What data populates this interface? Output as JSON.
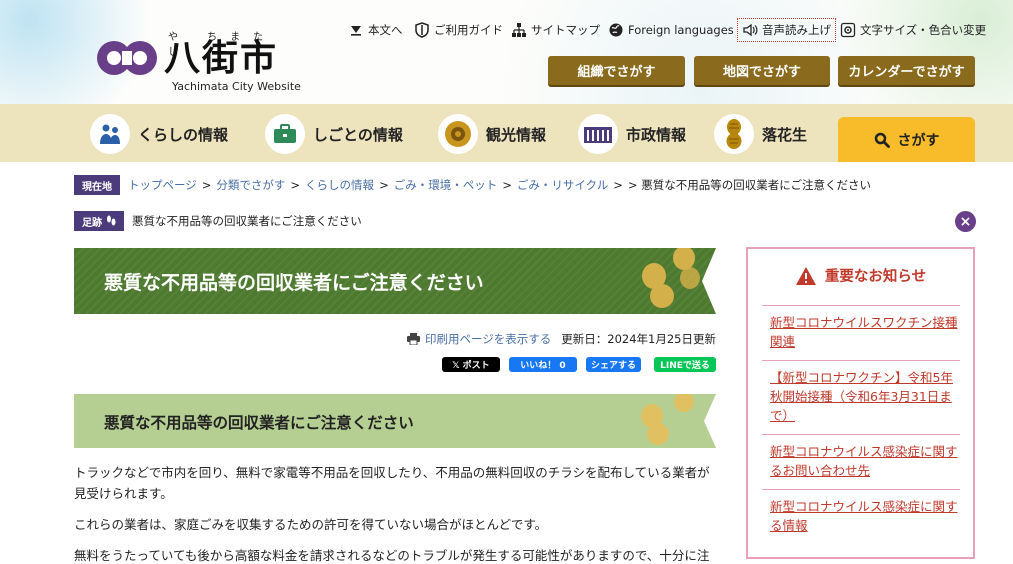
{
  "header": {
    "logo": {
      "kana": "や ちまた し",
      "kanji": "八街市",
      "en": "Yachimata City Website"
    },
    "utility": [
      {
        "label": "本文へ",
        "icon": "arrow-down-icon"
      },
      {
        "label": "ご利用ガイド",
        "icon": "shield-icon"
      },
      {
        "label": "サイトマップ",
        "icon": "sitemap-icon"
      },
      {
        "label": "Foreign languages",
        "icon": "globe-icon"
      },
      {
        "label": "音声読み上げ",
        "icon": "speaker-icon"
      },
      {
        "label": "文字サイズ・色合い変更",
        "icon": "gear-icon"
      }
    ],
    "search_buttons": [
      "組織でさがす",
      "地図でさがす",
      "カレンダーでさがす"
    ]
  },
  "nav": {
    "items": [
      {
        "label": "くらしの情報",
        "icon": "family-icon"
      },
      {
        "label": "しごとの情報",
        "icon": "briefcase-icon"
      },
      {
        "label": "観光情報",
        "icon": "sunflower-icon"
      },
      {
        "label": "市政情報",
        "icon": "building-icon"
      },
      {
        "label": "落花生",
        "icon": "peanut-icon"
      }
    ],
    "search_label": "さがす"
  },
  "breadcrumb": {
    "tag": "現在地",
    "links": [
      "トップページ",
      "分類でさがす",
      "くらしの情報",
      "ごみ・環境・ペット",
      "ごみ・リサイクル"
    ],
    "separator": ">",
    "current": "> 悪質な不用品等の回収業者にご注意ください"
  },
  "footprint": {
    "tag": "足跡",
    "current": "悪質な不用品等の回収業者にご注意ください"
  },
  "article": {
    "title": "悪質な不用品等の回収業者にご注意ください",
    "print_label": "印刷用ページを表示する",
    "updated": "更新日：2024年1月25日更新",
    "share": {
      "x": "𝕏 ポスト",
      "fb": "いいね！ 0",
      "hatena": "シェアする",
      "line": "LINEで送る"
    },
    "heading": "悪質な不用品等の回収業者にご注意ください",
    "paragraphs": [
      "トラックなどで市内を回り、無料で家電等不用品を回収したり、不用品の無料回収のチラシを配布している業者が見受けられます。",
      "これらの業者は、家庭ごみを収集するための許可を得ていない場合がほとんどです。",
      "無料をうたっていても後から高額な料金を請求されるなどのトラブルが発生する可能性がありますので、十分に注意"
    ]
  },
  "notice": {
    "title": "重要なお知らせ",
    "items": [
      "新型コロナウイルスワクチン接種関連",
      "【新型コロナワクチン】令和5年秋開始接種（令和6年3月31日まで）",
      "新型コロナウイルス感染症に関するお問い合わせ先",
      "新型コロナウイルス感染症に関する情報"
    ]
  },
  "colors": {
    "brand_purple": "#6a3f8a",
    "nav_bg": "#ede3bd",
    "search_btn": "#8a6a1d",
    "banner_green": "#4e7a2f",
    "sub_banner": "#b5cf93",
    "notice_red": "#c0392b"
  }
}
